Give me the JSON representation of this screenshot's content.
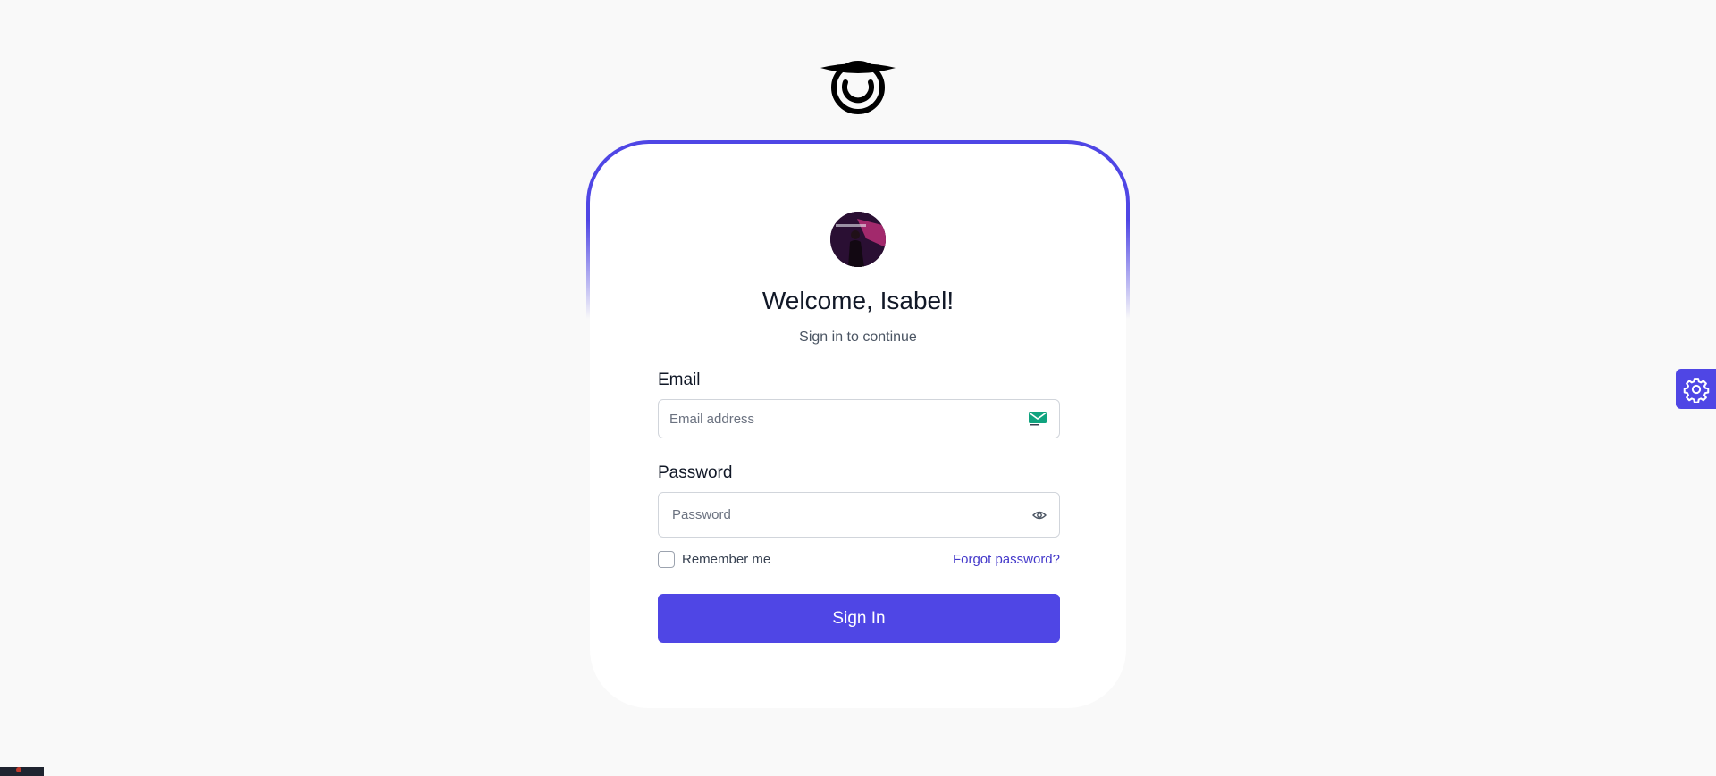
{
  "brand": {
    "logo_icon": "brand-logo-icon"
  },
  "card": {
    "avatar_icon": "user-avatar",
    "welcome": "Welcome, Isabel!",
    "subtitle": "Sign in to continue"
  },
  "form": {
    "email_label": "Email",
    "email_placeholder": "Email address",
    "email_value": "",
    "email_icon": "mail-icon",
    "password_label": "Password",
    "password_placeholder": "Password",
    "password_value": "",
    "password_icon": "eye-icon",
    "remember_label": "Remember me",
    "remember_checked": false,
    "forgot_label": "Forgot password?",
    "submit_label": "Sign In"
  },
  "floating": {
    "settings_icon": "gear-icon"
  },
  "colors": {
    "accent": "#4f46e5",
    "link": "#4338ca",
    "background": "#f9f9f9",
    "mail_icon": "#10a37f"
  }
}
